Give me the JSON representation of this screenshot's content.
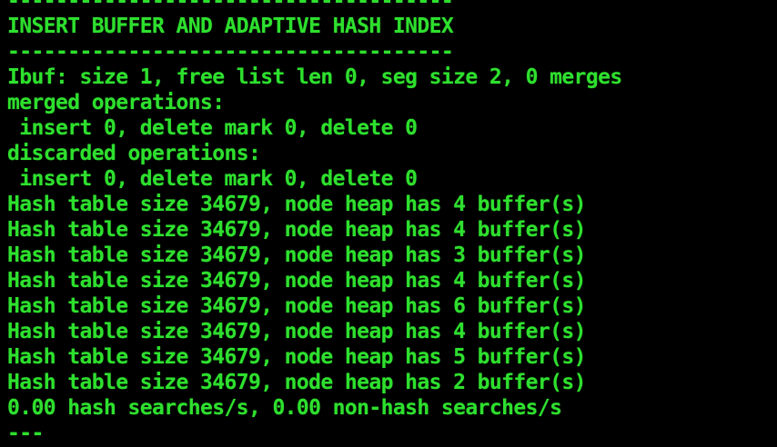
{
  "colors": {
    "background": "#000000",
    "text": "#2ee02e"
  },
  "terminal": {
    "lines": [
      "-------------------------------------",
      "INSERT BUFFER AND ADAPTIVE HASH INDEX",
      "-------------------------------------",
      "Ibuf: size 1, free list len 0, seg size 2, 0 merges",
      "merged operations:",
      " insert 0, delete mark 0, delete 0",
      "discarded operations:",
      " insert 0, delete mark 0, delete 0",
      "Hash table size 34679, node heap has 4 buffer(s)",
      "Hash table size 34679, node heap has 4 buffer(s)",
      "Hash table size 34679, node heap has 3 buffer(s)",
      "Hash table size 34679, node heap has 4 buffer(s)",
      "Hash table size 34679, node heap has 6 buffer(s)",
      "Hash table size 34679, node heap has 4 buffer(s)",
      "Hash table size 34679, node heap has 5 buffer(s)",
      "Hash table size 34679, node heap has 2 buffer(s)",
      "0.00 hash searches/s, 0.00 non-hash searches/s",
      "---"
    ]
  }
}
